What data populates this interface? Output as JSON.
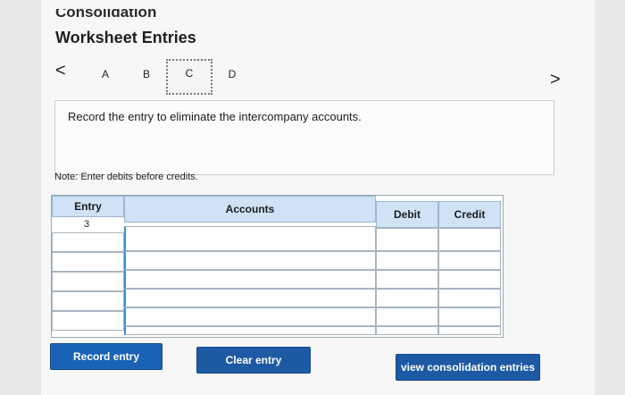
{
  "header": {
    "cut_title": "Consolidation",
    "title": "Worksheet Entries"
  },
  "tabs": [
    {
      "label": "A"
    },
    {
      "label": "B"
    },
    {
      "label": "C"
    },
    {
      "label": "D"
    }
  ],
  "nav": {
    "prev_icon": "chevron-left-icon",
    "next_icon": "chevron-right-icon",
    "prev": "<",
    "next": ">"
  },
  "instruction": "Record the entry to eliminate the intercompany accounts.",
  "note": "Note: Enter debits before credits.",
  "table": {
    "headers": {
      "entry": "Entry",
      "accounts": "Accounts",
      "debit": "Debit",
      "credit": "Credit"
    },
    "entry_value": "3"
  },
  "buttons": {
    "record": "Record entry",
    "clear": "Clear entry",
    "view": "view consolidation entries"
  }
}
